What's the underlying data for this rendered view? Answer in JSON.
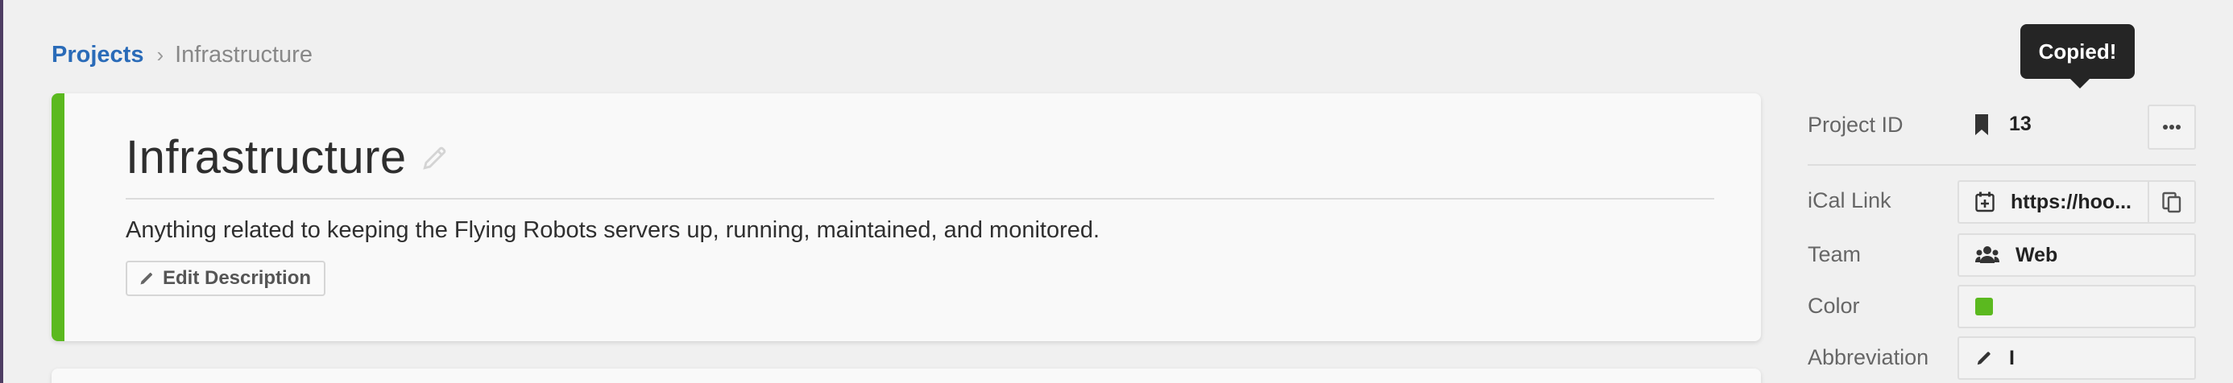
{
  "breadcrumb": {
    "root": "Projects",
    "separator": "›",
    "current": "Infrastructure"
  },
  "project": {
    "title": "Infrastructure",
    "description": "Anything related to keeping the Flying Robots servers up, running, maintained, and monitored.",
    "edit_description_label": "Edit Description",
    "accent_color": "#5bb91f"
  },
  "sidebar": {
    "tooltip": "Copied!",
    "project_id": {
      "label": "Project ID",
      "value": "13",
      "icon": "bookmark-icon",
      "more_icon": "ellipsis-icon"
    },
    "ical": {
      "label": "iCal Link",
      "value": "https://hoo...",
      "icon": "calendar-plus-icon",
      "copy_icon": "clipboard-icon"
    },
    "team": {
      "label": "Team",
      "value": "Web",
      "icon": "users-icon"
    },
    "color": {
      "label": "Color",
      "value": "#5bb91f"
    },
    "abbreviation": {
      "label": "Abbreviation",
      "value": "I",
      "icon": "pencil-icon"
    }
  }
}
